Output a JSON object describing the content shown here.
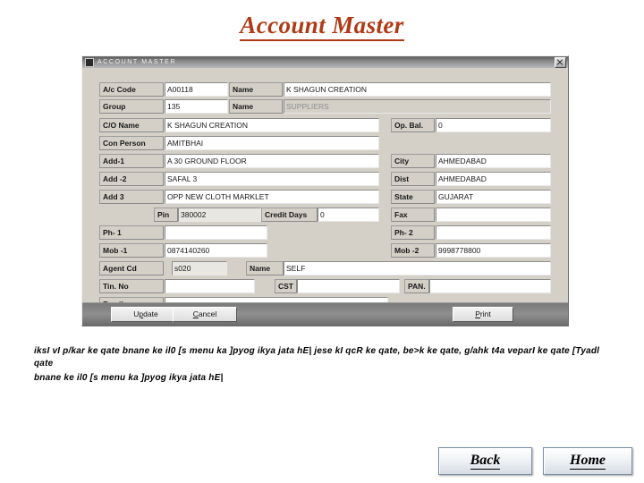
{
  "slide": {
    "title": "Account Master"
  },
  "window": {
    "title": "ACCOUNT MASTER",
    "icon": "app-icon",
    "close_icon": "close-icon"
  },
  "form": {
    "fields": [
      {
        "key": "ac_code",
        "label": "A/c Code",
        "value": "A00118"
      },
      {
        "key": "ac_name",
        "label": "Name",
        "value": "K SHAGUN CREATION"
      },
      {
        "key": "group",
        "label": "Group",
        "value": "135"
      },
      {
        "key": "group_name",
        "label": "Name",
        "value": "SUPPLIERS"
      },
      {
        "key": "co_name",
        "label": "C/O Name",
        "value": "K SHAGUN CREATION"
      },
      {
        "key": "op_bal",
        "label": "Op. Bal.",
        "value": "0"
      },
      {
        "key": "con_person",
        "label": "Con Person",
        "value": "AMITBHAI"
      },
      {
        "key": "add1",
        "label": "Add-1",
        "value": "A 30 GROUND FLOOR"
      },
      {
        "key": "city",
        "label": "City",
        "value": "AHMEDABAD"
      },
      {
        "key": "add2",
        "label": "Add -2",
        "value": "SAFAL 3"
      },
      {
        "key": "dist",
        "label": "Dist",
        "value": "AHMEDABAD"
      },
      {
        "key": "add3",
        "label": "Add 3",
        "value": "OPP NEW CLOTH MARKLET"
      },
      {
        "key": "state",
        "label": "State",
        "value": "GUJARAT"
      },
      {
        "key": "pin",
        "label": "Pin",
        "value": "380002"
      },
      {
        "key": "credit_days",
        "label": "Credit Days",
        "value": "0"
      },
      {
        "key": "fax",
        "label": "Fax",
        "value": ""
      },
      {
        "key": "ph1",
        "label": "Ph- 1",
        "value": ""
      },
      {
        "key": "ph2",
        "label": "Ph- 2",
        "value": ""
      },
      {
        "key": "mob1",
        "label": "Mob -1",
        "value": "0874140260"
      },
      {
        "key": "mob2",
        "label": "Mob -2",
        "value": "9998778800"
      },
      {
        "key": "agent_cd",
        "label": "Agent Cd",
        "value": "s020"
      },
      {
        "key": "agent_name",
        "label": "Name",
        "value": "SELF"
      },
      {
        "key": "tin_no",
        "label": "Tin. No",
        "value": ""
      },
      {
        "key": "cst",
        "label": "CST",
        "value": ""
      },
      {
        "key": "pan",
        "label": "PAN.",
        "value": ""
      },
      {
        "key": "email",
        "label": "Email",
        "value": ""
      }
    ]
  },
  "dialog_buttons": {
    "update": {
      "pre": "U",
      "mnemonic": "p",
      "post": "date"
    },
    "cancel": {
      "pre": "",
      "mnemonic": "C",
      "post": "ancel"
    },
    "print": {
      "pre": "",
      "mnemonic": "P",
      "post": "rint"
    }
  },
  "body": {
    "para1": "iksI vI p/kar ke qate bnane ke il0 [s menu ka ]pyog ikya jata hE| jese kI qcR ke qate, be>k ke qate, g/ahk t4a veparI ke qate [Tyadl qate",
    "para2": "bnane ke il0 [s menu ka ]pyog ikya jata hE|"
  },
  "nav": {
    "back": "Back",
    "home": "Home"
  },
  "colors": {
    "title_accent": "#b03a16",
    "window_face": "#d4d0c8",
    "nav_border": "#7b8fa6"
  }
}
